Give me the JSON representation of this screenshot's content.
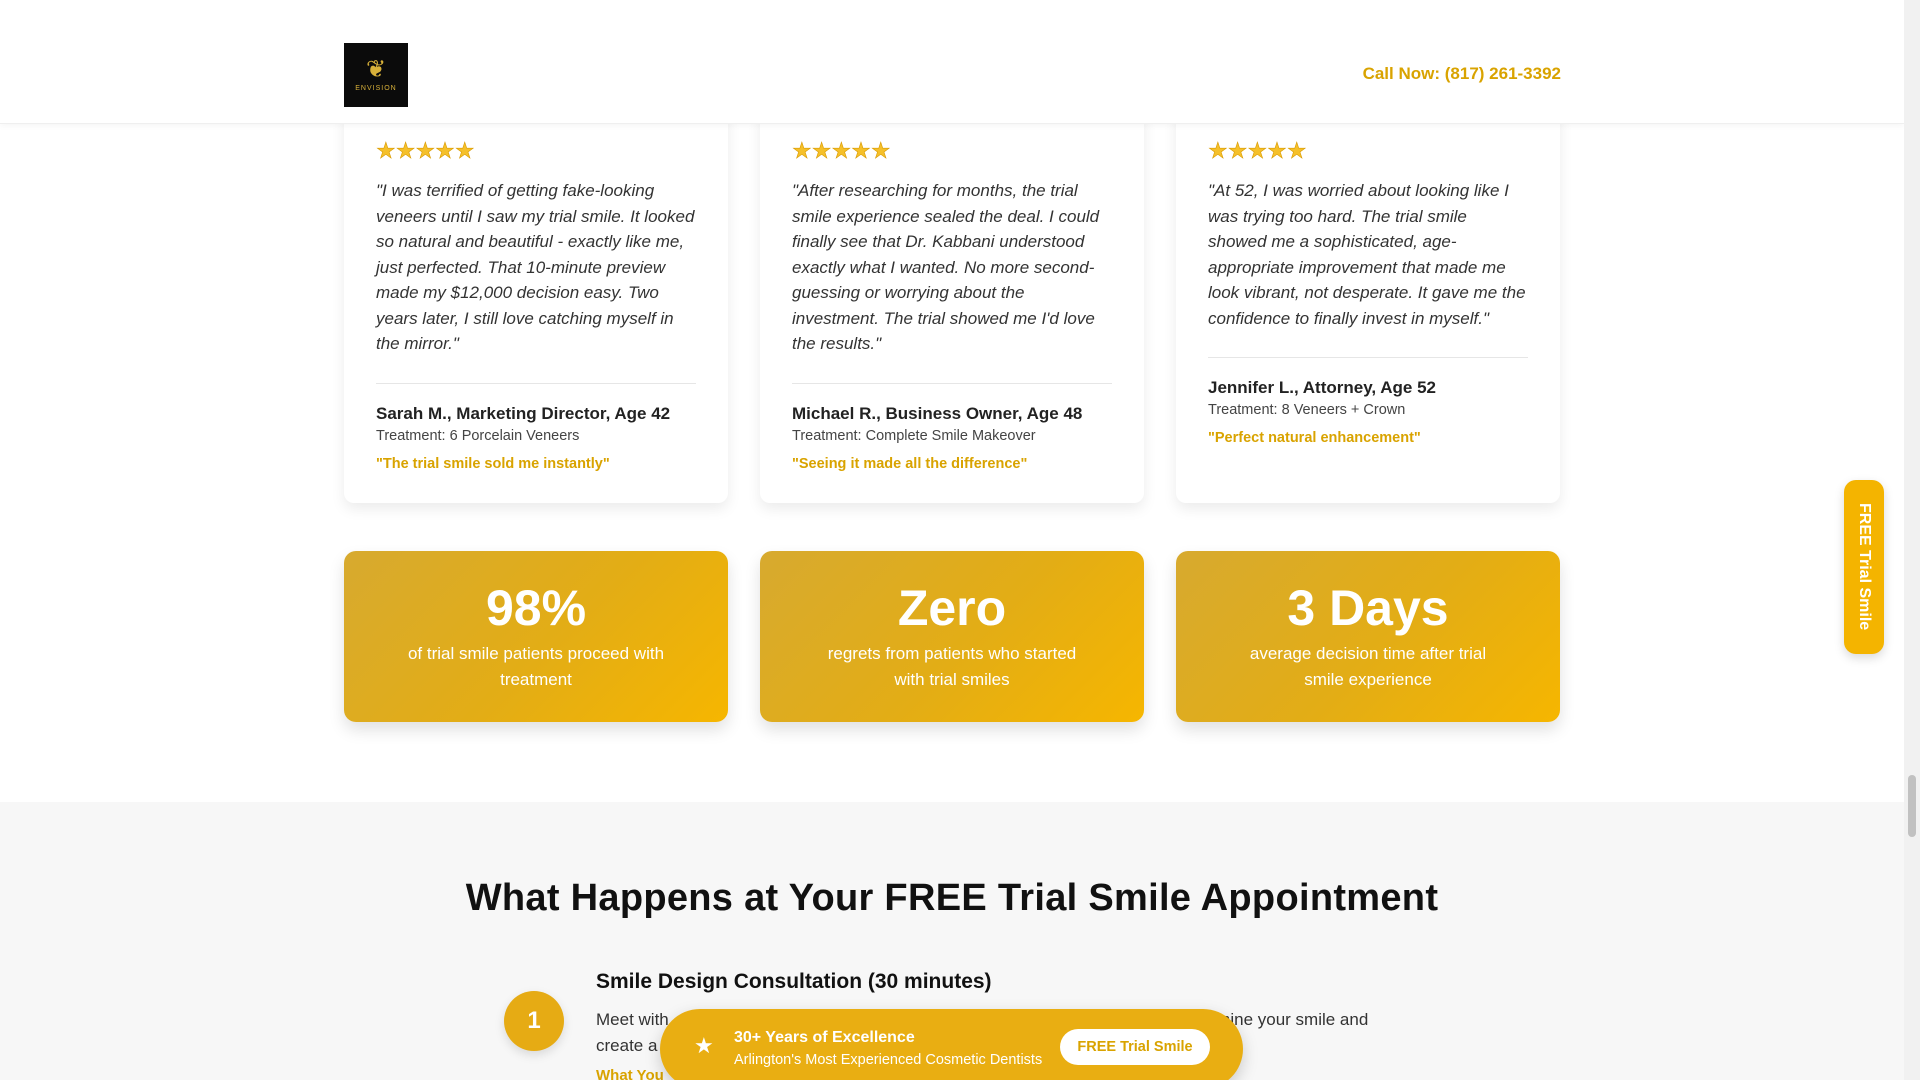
{
  "header": {
    "logo_text": "ENVISION",
    "call_now": "Call Now: (817) 261-3392"
  },
  "testimonials": [
    {
      "stars": "★★★★★",
      "quote": "\"I was terrified of getting fake-looking veneers until I saw my trial smile. It looked so natural and beautiful - exactly like me, just perfected. That 10-minute preview made my $12,000 decision easy. Two years later, I still love catching myself in the mirror.\"",
      "author": "Sarah M., Marketing Director, Age 42",
      "treatment": "Treatment: 6 Porcelain Veneers",
      "tagline": "\"The trial smile sold me instantly\""
    },
    {
      "stars": "★★★★★",
      "quote": "\"After researching for months, the trial smile experience sealed the deal. I could finally see that Dr. Kabbani understood exactly what I wanted. No more second-guessing or worrying about the investment. The trial showed me I'd love the results.\"",
      "author": "Michael R., Business Owner, Age 48",
      "treatment": "Treatment: Complete Smile Makeover",
      "tagline": "\"Seeing it made all the difference\""
    },
    {
      "stars": "★★★★★",
      "quote": "\"At 52, I was worried about looking like I was trying too hard. The trial smile showed me a sophisticated, age-appropriate improvement that made me look vibrant, not desperate. It gave me the confidence to finally invest in myself.\"",
      "author": "Jennifer L., Attorney, Age 52",
      "treatment": "Treatment: 8 Veneers + Crown",
      "tagline": "\"Perfect natural enhancement\""
    }
  ],
  "stats": [
    {
      "value": "98%",
      "label": "of trial smile patients proceed with treatment"
    },
    {
      "value": "Zero",
      "label": "regrets from patients who started with trial smiles"
    },
    {
      "value": "3 Days",
      "label": "average decision time after trial smile experience"
    }
  ],
  "section": {
    "title": "What Happens at Your FREE Trial Smile Appointment",
    "step": {
      "number": "1",
      "title": "Smile Design Consultation (30 minutes)",
      "desc_start": "Meet with",
      "desc_end": "xamine your smile and",
      "desc_line2": "create a",
      "link": "What You"
    }
  },
  "side_tab": {
    "label": "FREE Trial Smile"
  },
  "bottom_bar": {
    "title": "30+ Years of Excellence",
    "subtitle": "Arlington's Most Experienced Cosmetic Dentists",
    "button": "FREE Trial Smile"
  },
  "colors": {
    "accent": "#e6ab14",
    "accent_text": "#d9a300"
  }
}
